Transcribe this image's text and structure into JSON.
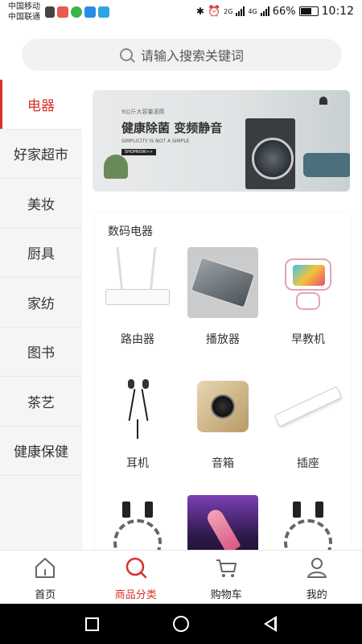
{
  "status_bar": {
    "carrier_1": "中国移动",
    "carrier_2": "中国联通",
    "network_1": "2G",
    "network_2": "4G",
    "battery": "66%",
    "time": "10:12"
  },
  "search": {
    "placeholder": "请输入搜索关键词"
  },
  "sidebar": {
    "items": [
      {
        "label": "电器",
        "active": true
      },
      {
        "label": "好家超市"
      },
      {
        "label": "美妆"
      },
      {
        "label": "厨具"
      },
      {
        "label": "家纺"
      },
      {
        "label": "图书"
      },
      {
        "label": "茶艺"
      },
      {
        "label": "健康保健"
      }
    ]
  },
  "banner": {
    "tag": "9公斤大容量滚筒",
    "title": "健康除菌 变频静音",
    "subtitle": "SIMPLICITY IS NOT A SIMPLE",
    "button": "SHOPNOW>>"
  },
  "category": {
    "title": "数码电器",
    "items": [
      {
        "label": "路由器",
        "icon": "router-icon"
      },
      {
        "label": "播放器",
        "icon": "player-icon"
      },
      {
        "label": "早教机",
        "icon": "robot-icon"
      },
      {
        "label": "耳机",
        "icon": "earphone-icon"
      },
      {
        "label": "音箱",
        "icon": "speaker-icon"
      },
      {
        "label": "插座",
        "icon": "power-strip-icon"
      },
      {
        "label": "",
        "icon": "cable-icon"
      },
      {
        "label": "",
        "icon": "microphone-icon"
      },
      {
        "label": "",
        "icon": "cable-icon"
      }
    ]
  },
  "tabbar": {
    "items": [
      {
        "label": "首页",
        "icon": "home-icon"
      },
      {
        "label": "商品分类",
        "icon": "category-search-icon",
        "active": true
      },
      {
        "label": "购物车",
        "icon": "cart-icon"
      },
      {
        "label": "我的",
        "icon": "user-icon"
      }
    ]
  },
  "colors": {
    "accent": "#d7312b",
    "sidebar_bg": "#f5f5f5",
    "search_bg": "#f2f2f2"
  }
}
